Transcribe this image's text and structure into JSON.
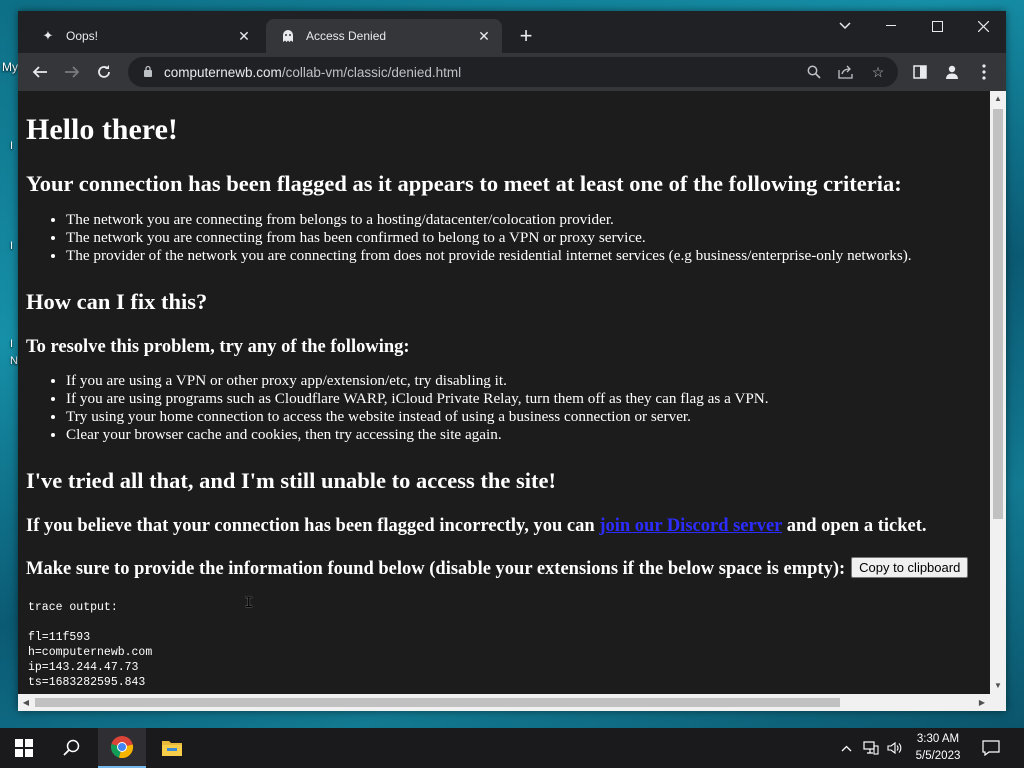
{
  "desktop": {
    "label": "My",
    "fragments": [
      "I",
      "I",
      "I",
      "N"
    ]
  },
  "tabs": [
    {
      "title": "Oops!",
      "icon": "sparkle-icon",
      "active": false
    },
    {
      "title": "Access Denied",
      "icon": "ghost-icon",
      "active": true
    }
  ],
  "toolbar": {
    "url_host": "computernewb.com",
    "url_path": "/collab-vm/classic/denied.html"
  },
  "page": {
    "heading": "Hello there!",
    "flagged_heading": "Your connection has been flagged as it appears to meet at least one of the following criteria:",
    "criteria": [
      "The network you are connecting from belongs to a hosting/datacenter/colocation provider.",
      "The network you are connecting from has been confirmed to belong to a VPN or proxy service.",
      "The provider of the network you are connecting from does not provide residential internet services (e.g business/enterprise-only networks)."
    ],
    "fix_heading": "How can I fix this?",
    "resolve_text": "To resolve this problem, try any of the following:",
    "fixes": [
      "If you are using a VPN or other proxy app/extension/etc, try disabling it.",
      "If you are using programs such as Cloudflare WARP, iCloud Private Relay, turn them off as they can flag as a VPN.",
      "Try using your home connection to access the website instead of using a business connection or server.",
      "Clear your browser cache and cookies, then try accessing the site again."
    ],
    "tried_heading": "I've tried all that, and I'm still unable to access the site!",
    "believe_prefix": "If you believe that your connection has been flagged incorrectly, you can ",
    "discord_link": "join our Discord server",
    "believe_suffix": " and open a ticket.",
    "provide_text": "Make sure to provide the information found below (disable your extensions if the below space is empty):",
    "copy_button": "Copy to clipboard",
    "trace_label": "trace output:",
    "trace_lines": [
      "fl=11f593",
      "h=computernewb.com",
      "ip=143.244.47.73",
      "ts=1683282595.843"
    ]
  },
  "taskbar": {
    "time": "3:30 AM",
    "date": "5/5/2023"
  }
}
